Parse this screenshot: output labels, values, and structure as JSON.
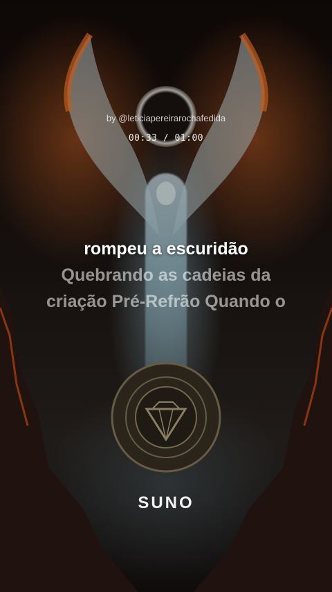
{
  "byline": "by @leticiapereirarochafedida",
  "timer": {
    "current": "00:33",
    "separator": " / ",
    "total": "01:00"
  },
  "lyrics": {
    "current": "rompeu a escuridão",
    "next": [
      "Quebrando as cadeias da",
      "criação Pré-Refrão Quando o"
    ]
  },
  "logo": "SUNO",
  "colors": {
    "lyric_current": "#ffffff",
    "lyric_next": "#bdbdbd",
    "flame": "#e0662a",
    "angel_glow": "#a8cfdc"
  },
  "icons": {
    "background": "angel-artwork-icon",
    "emblem": "diamond-emblem-icon"
  }
}
